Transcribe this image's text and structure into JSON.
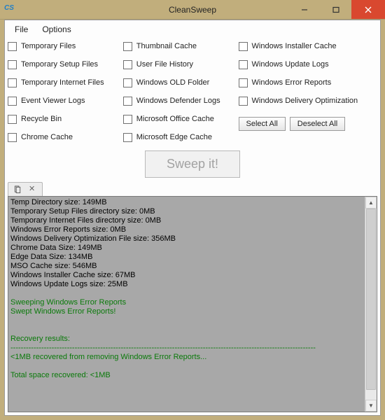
{
  "window": {
    "title": "CleanSweep",
    "icon_text": "CS"
  },
  "menu": {
    "file": "File",
    "options": "Options"
  },
  "checkboxes": {
    "col1": [
      "Temporary Files",
      "Temporary Setup Files",
      "Temporary Internet Files",
      "Event Viewer Logs",
      "Recycle Bin",
      "Chrome Cache"
    ],
    "col2": [
      "Thumbnail Cache",
      "User File History",
      "Windows OLD Folder",
      "Windows Defender Logs",
      "Microsoft Office Cache",
      "Microsoft Edge Cache"
    ],
    "col3": [
      "Windows Installer Cache",
      "Windows Update Logs",
      "Windows Error Reports",
      "Windows Delivery Optimization"
    ]
  },
  "buttons": {
    "select_all": "Select All",
    "deselect_all": "Deselect All",
    "sweep": "Sweep it!"
  },
  "log": {
    "plain": "Temp Directory size: 149MB\nTemporary Setup Files directory size: 0MB\nTemporary Internet Files directory size: 0MB\nWindows Error Reports size: 0MB\nWindows Delivery Optimization File size: 356MB\nChrome Data Size: 149MB\nEdge Data Size: 134MB\nMSO Cache size: 546MB\nWindows Installer Cache size: 67MB\nWindows Update Logs size: 25MB\n",
    "sweeping": "Sweeping Windows Error Reports",
    "swept": "Swept Windows Error Reports!",
    "results_header": "Recovery results:",
    "divider": "-----------------------------------------------------------------------------------------------------------------------",
    "recovered_line": "<1MB recovered from removing Windows Error Reports...",
    "total": "Total space recovered: <1MB"
  }
}
